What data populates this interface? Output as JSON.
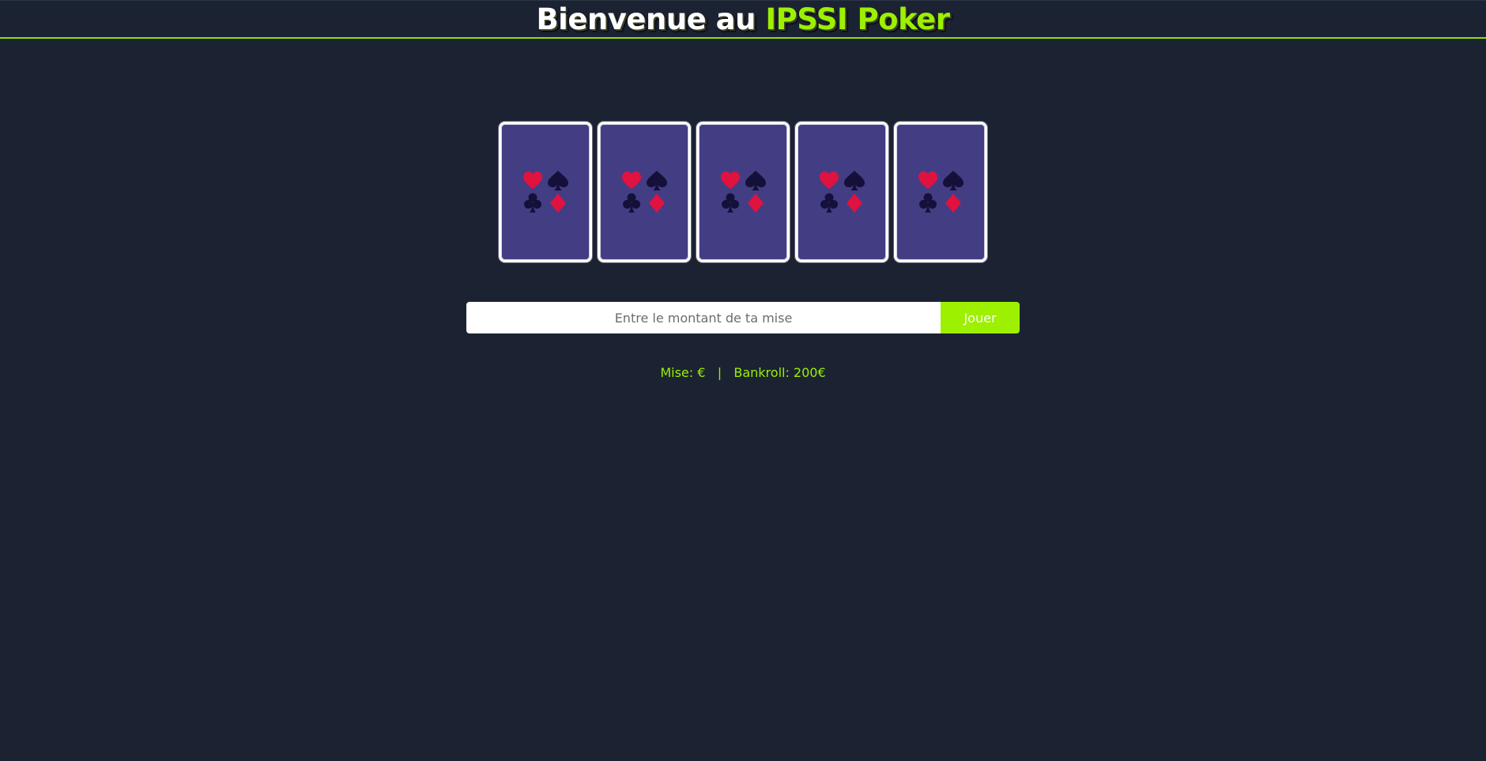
{
  "header": {
    "title_prefix": "Bienvenue au ",
    "title_brand": "IPSSI Poker"
  },
  "cards": [
    {
      "face": "back",
      "suits": [
        "heart-icon",
        "spade-icon",
        "club-icon",
        "diamond-icon"
      ]
    },
    {
      "face": "back",
      "suits": [
        "heart-icon",
        "spade-icon",
        "club-icon",
        "diamond-icon"
      ]
    },
    {
      "face": "back",
      "suits": [
        "heart-icon",
        "spade-icon",
        "club-icon",
        "diamond-icon"
      ]
    },
    {
      "face": "back",
      "suits": [
        "heart-icon",
        "spade-icon",
        "club-icon",
        "diamond-icon"
      ]
    },
    {
      "face": "back",
      "suits": [
        "heart-icon",
        "spade-icon",
        "club-icon",
        "diamond-icon"
      ]
    }
  ],
  "bet": {
    "value": "",
    "placeholder": "Entre le montant de ta mise",
    "button_label": "Jouer"
  },
  "status": {
    "mise_label": "Mise: €",
    "separator": "|",
    "bankroll_label": "Bankroll: 200€"
  },
  "colors": {
    "background": "#1b2333",
    "accent": "#9cf000",
    "card_back": "#433d84",
    "suit_red": "#e0123f",
    "suit_dark": "#14103a"
  }
}
